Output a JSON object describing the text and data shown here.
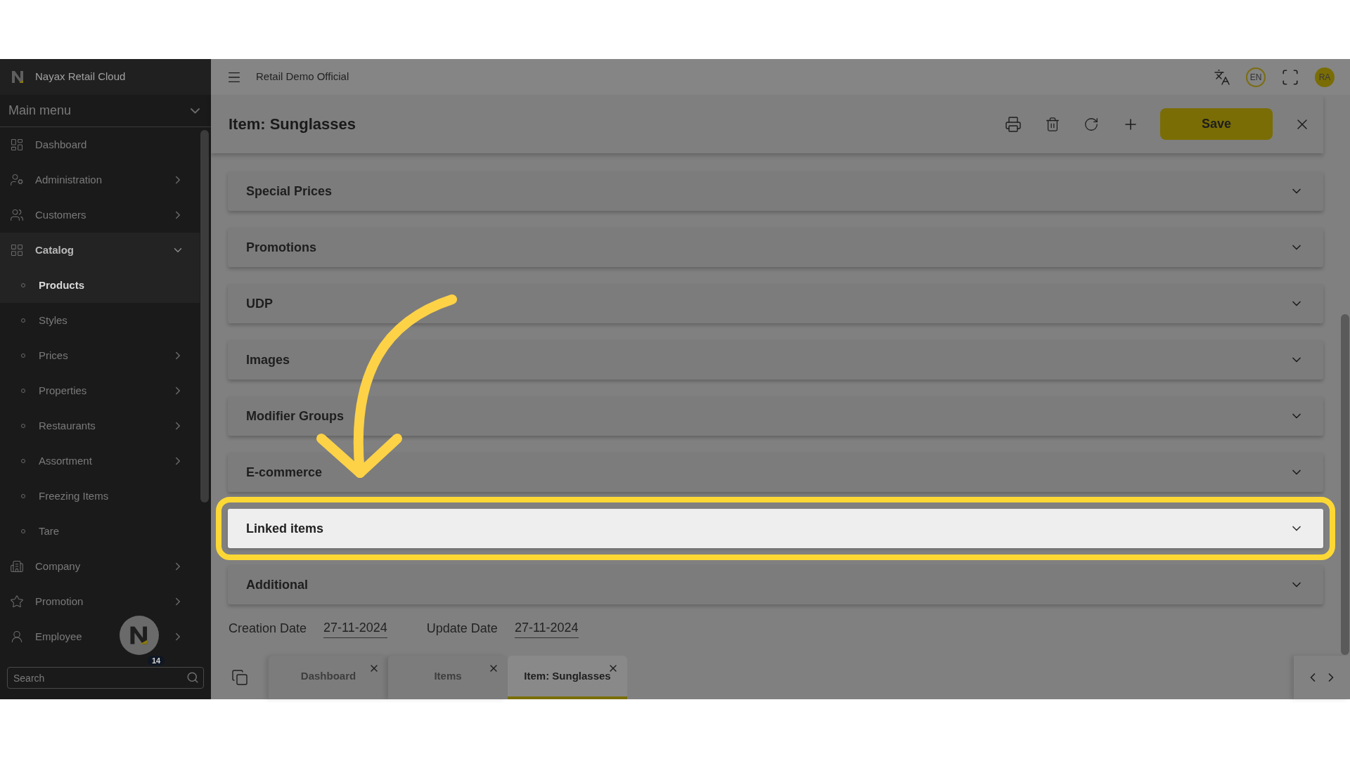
{
  "app": {
    "name": "Nayax Retail Cloud"
  },
  "sidebar": {
    "menu_title": "Main menu",
    "items": [
      {
        "label": "Dashboard",
        "has_submenu": false,
        "expanded": false,
        "selected": false
      },
      {
        "label": "Administration",
        "has_submenu": true,
        "expanded": false,
        "selected": false
      },
      {
        "label": "Customers",
        "has_submenu": true,
        "expanded": false,
        "selected": false
      },
      {
        "label": "Catalog",
        "has_submenu": true,
        "expanded": true,
        "selected": false,
        "children": [
          {
            "label": "Products",
            "has_submenu": false,
            "selected": true
          },
          {
            "label": "Styles",
            "has_submenu": false,
            "selected": false
          },
          {
            "label": "Prices",
            "has_submenu": true,
            "selected": false
          },
          {
            "label": "Properties",
            "has_submenu": true,
            "selected": false
          },
          {
            "label": "Restaurants",
            "has_submenu": true,
            "selected": false
          },
          {
            "label": "Assortment",
            "has_submenu": true,
            "selected": false
          },
          {
            "label": "Freezing Items",
            "has_submenu": false,
            "selected": false
          },
          {
            "label": "Tare",
            "has_submenu": false,
            "selected": false
          }
        ]
      },
      {
        "label": "Company",
        "has_submenu": true,
        "expanded": false,
        "selected": false
      },
      {
        "label": "Promotion",
        "has_submenu": true,
        "expanded": false,
        "selected": false
      },
      {
        "label": "Employee",
        "has_submenu": true,
        "expanded": false,
        "selected": false
      }
    ],
    "search": {
      "placeholder": "Search"
    },
    "widget_badge": "14"
  },
  "header": {
    "title": "Retail Demo Official",
    "language": "EN",
    "avatar": "RA"
  },
  "form": {
    "title": "Item: Sunglasses",
    "save": "Save",
    "sections": [
      {
        "title": "Special Prices",
        "highlighted": false
      },
      {
        "title": "Promotions",
        "highlighted": false
      },
      {
        "title": "UDP",
        "highlighted": false
      },
      {
        "title": "Images",
        "highlighted": false
      },
      {
        "title": "Modifier Groups",
        "highlighted": false
      },
      {
        "title": "E-commerce",
        "highlighted": false
      },
      {
        "title": "Linked items",
        "highlighted": true
      },
      {
        "title": "Additional",
        "highlighted": false
      }
    ],
    "dates": [
      {
        "label": "Creation Date",
        "value": "27-11-2024"
      },
      {
        "label": "Update Date",
        "value": "27-11-2024"
      }
    ]
  },
  "bottom_tabs": [
    {
      "label": "Dashboard",
      "selected": false
    },
    {
      "label": "Items",
      "selected": false
    },
    {
      "label": "Item: Sunglasses",
      "selected": true
    }
  ]
}
